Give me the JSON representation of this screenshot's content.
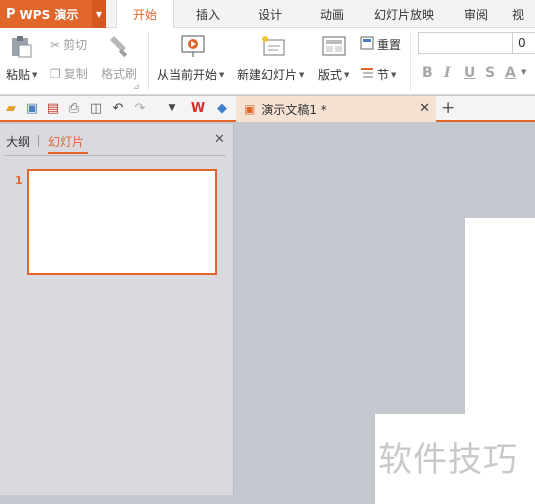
{
  "app": {
    "logo": "P",
    "name": "WPS 演示"
  },
  "ribbon_tabs": [
    "开始",
    "插入",
    "设计",
    "动画",
    "幻灯片放映",
    "审阅",
    "视"
  ],
  "active_tab": "开始",
  "ribbon": {
    "paste": "粘贴",
    "cut": "剪切",
    "copy": "复制",
    "format_painter": "格式刷",
    "play_from_current": "从当前开始",
    "new_slide": "新建幻灯片",
    "layout": "版式",
    "reset": "重置",
    "section": "节",
    "font_size": "0",
    "format_buttons": [
      "B",
      "I",
      "U",
      "S",
      "A"
    ]
  },
  "document_tab": {
    "title": "演示文稿1 *"
  },
  "panel": {
    "tab_outline": "大纲",
    "tab_slides": "幻灯片",
    "slide_number": "1"
  },
  "watermark": "软件技巧",
  "colors": {
    "accent": "#e0662b",
    "canvas": "#c6c8cf",
    "panel": "#d9dadf"
  }
}
